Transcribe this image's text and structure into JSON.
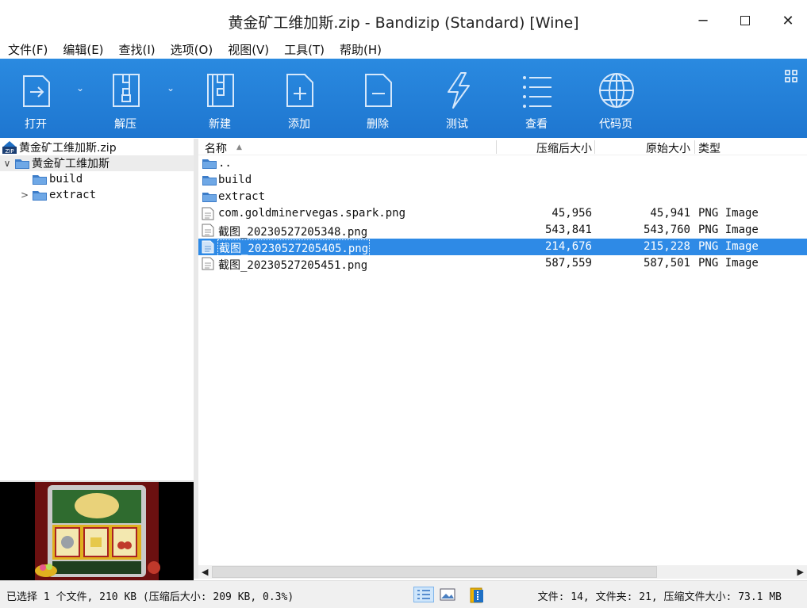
{
  "window": {
    "title": "黄金矿工维加斯.zip - Bandizip (Standard) [Wine]",
    "minimize_glyph": "─",
    "close_glyph": "✕"
  },
  "menu": [
    "文件(F)",
    "编辑(E)",
    "查找(I)",
    "选项(O)",
    "视图(V)",
    "工具(T)",
    "帮助(H)"
  ],
  "toolbar": {
    "open": "打开",
    "extract": "解压",
    "new": "新建",
    "add": "添加",
    "delete": "删除",
    "test": "测试",
    "view": "查看",
    "codepage": "代码页",
    "dropdown_glyph": "⌄"
  },
  "tree": {
    "archive": "黄金矿工维加斯.zip",
    "root": "黄金矿工维加斯",
    "children": [
      "build",
      "extract"
    ],
    "expand_glyph": "∨",
    "collapsed_glyph": ">"
  },
  "list": {
    "columns": {
      "name": "名称",
      "compressed": "压缩后大小",
      "original": "原始大小",
      "type": "类型",
      "sort_glyph": "▲"
    },
    "rows": [
      {
        "name": "..",
        "compressed": "",
        "original": "",
        "type": "",
        "kind": "folder"
      },
      {
        "name": "build",
        "compressed": "",
        "original": "",
        "type": "",
        "kind": "folder"
      },
      {
        "name": "extract",
        "compressed": "",
        "original": "",
        "type": "",
        "kind": "folder"
      },
      {
        "name": "com.goldminervegas.spark.png",
        "compressed": "45,956",
        "original": "45,941",
        "type": "PNG Image",
        "kind": "file"
      },
      {
        "name": "截图_20230527205348.png",
        "compressed": "543,841",
        "original": "543,760",
        "type": "PNG Image",
        "kind": "file"
      },
      {
        "name": "截图_20230527205405.png",
        "compressed": "214,676",
        "original": "215,228",
        "type": "PNG Image",
        "kind": "file",
        "selected": true
      },
      {
        "name": "截图_20230527205451.png",
        "compressed": "587,559",
        "original": "587,501",
        "type": "PNG Image",
        "kind": "file"
      }
    ]
  },
  "scrollbar": {
    "left": "◀",
    "right": "▶"
  },
  "status": {
    "left": "已选择 1 个文件, 210 KB (压缩后大小: 209 KB, 0.3%)",
    "right": "文件: 14, 文件夹: 21, 压缩文件大小: 73.1 MB"
  },
  "colors": {
    "toolbar": "#2a8ae0",
    "selection": "#2e8ae6",
    "folder": "#3c7cc8"
  }
}
